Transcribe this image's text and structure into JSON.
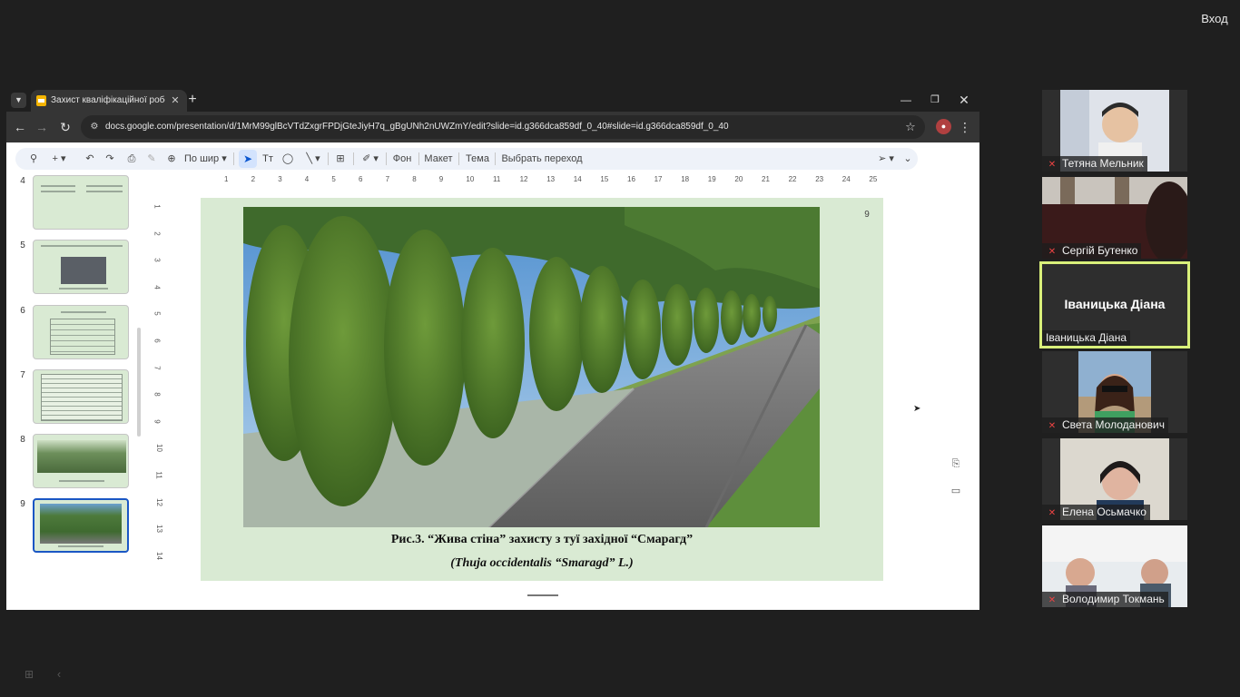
{
  "login_label": "Вход",
  "browser": {
    "tab_title": "Захист кваліфікаційної робо",
    "tab_close": "✕",
    "new_tab": "+",
    "url": "docs.google.com/presentation/d/1MrM99glBcVTdZxgrFPDjGteJiyH7q_gBgUNh2nUWZmY/edit?slide=id.g366dca859df_0_40#slide=id.g366dca859df_0_40"
  },
  "toolbar": {
    "zoom_label": "По шир",
    "background_label": "Фон",
    "layout_label": "Макет",
    "theme_label": "Тема",
    "transition_label": "Выбрать переход"
  },
  "filmstrip": {
    "slides": [
      "4",
      "5",
      "6",
      "7",
      "8",
      "9"
    ],
    "active_slide": "9"
  },
  "ruler": {
    "h_ticks": [
      "1",
      "2",
      "3",
      "4",
      "5",
      "6",
      "7",
      "8",
      "9",
      "10",
      "11",
      "12",
      "13",
      "14",
      "15",
      "16",
      "17",
      "18",
      "19",
      "20",
      "21",
      "22",
      "23",
      "24",
      "25"
    ],
    "v_ticks": [
      "1",
      "2",
      "3",
      "4",
      "5",
      "6",
      "7",
      "8",
      "9",
      "10",
      "11",
      "12",
      "13",
      "14"
    ]
  },
  "slide": {
    "page_number": "9",
    "caption_line1": "Рис.3. “Жива стіна” захисту з туї західної “Смарагд”",
    "caption_line2": "(Thuja occidentalis “Smaragd” L.)"
  },
  "participants": [
    {
      "name": "Тетяна Мельник",
      "muted": true
    },
    {
      "name": "Сергій Бутенко",
      "muted": true
    },
    {
      "name": "Іваницька Діана",
      "muted": false,
      "active": true
    },
    {
      "name": "Света Молоданович",
      "muted": true
    },
    {
      "name": "Елена Осьмачко",
      "muted": true
    },
    {
      "name": "Володимир Токмань",
      "muted": true
    }
  ],
  "colors": {
    "slide_background": "#d9ead3",
    "active_speaker_border": "#d9f07a",
    "accent_blue": "#1a56c4",
    "mic_off": "#e44444"
  }
}
